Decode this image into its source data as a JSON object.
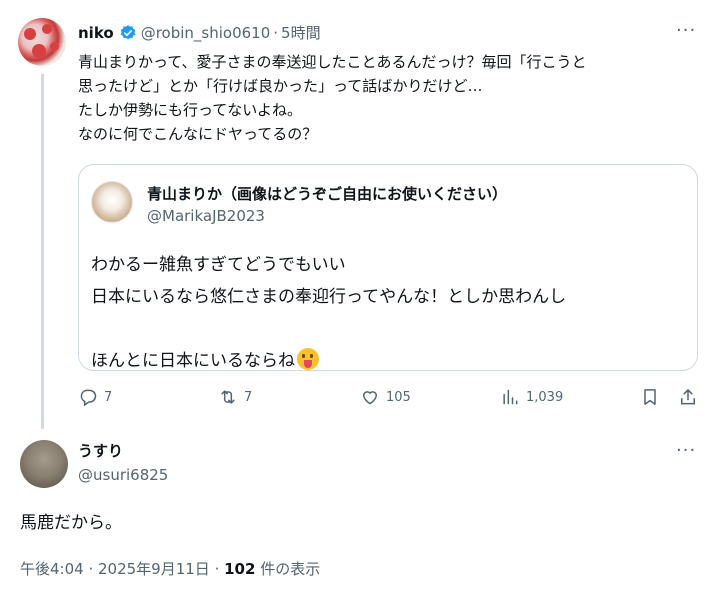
{
  "tweet": {
    "author_name": "niko",
    "author_handle": "@robin_shio0610",
    "time": "5時間",
    "lines": [
      "青山まりかって、愛子さまの奉送迎したことあるんだっけ？毎回「行こうと",
      "思ったけど」とか「行けば良かった」って話ばかりだけど…",
      "たしか伊勢にも行ってないよね。",
      "なのに何でこんなにドヤってるの？"
    ],
    "quote": {
      "author_name": "青山まりか（画像はどうぞご自由にお使いください）",
      "author_handle": "@MarikaJB2023",
      "lines": [
        "わかるー雑魚すぎてどうでもいい",
        "日本にいるなら悠仁さまの奉迎行ってやんな！としか思わんし",
        "",
        "ほんとに日本にいるならね"
      ],
      "emoji": "face-with-tongue-emoji"
    },
    "actions": {
      "reply_count": "7",
      "retweet_count": "7",
      "like_count": "105",
      "view_count": "1,039"
    }
  },
  "reply": {
    "author_name": "うすり",
    "author_handle": "@usuri6825",
    "text": "馬鹿だから。",
    "timestamp": "午後4:04 · 2025年9月11日",
    "separator": " · ",
    "views_number": "102",
    "views_label": " 件の表示"
  },
  "more_label": "···",
  "icons": [
    "verified-icon",
    "reply-icon",
    "retweet-icon",
    "like-icon",
    "views-icon",
    "bookmark-icon",
    "share-icon",
    "more-icon"
  ],
  "colors": {
    "text": "#0f1419",
    "muted": "#536471",
    "border": "#cfd9de",
    "verified": "#1d9bf0"
  }
}
